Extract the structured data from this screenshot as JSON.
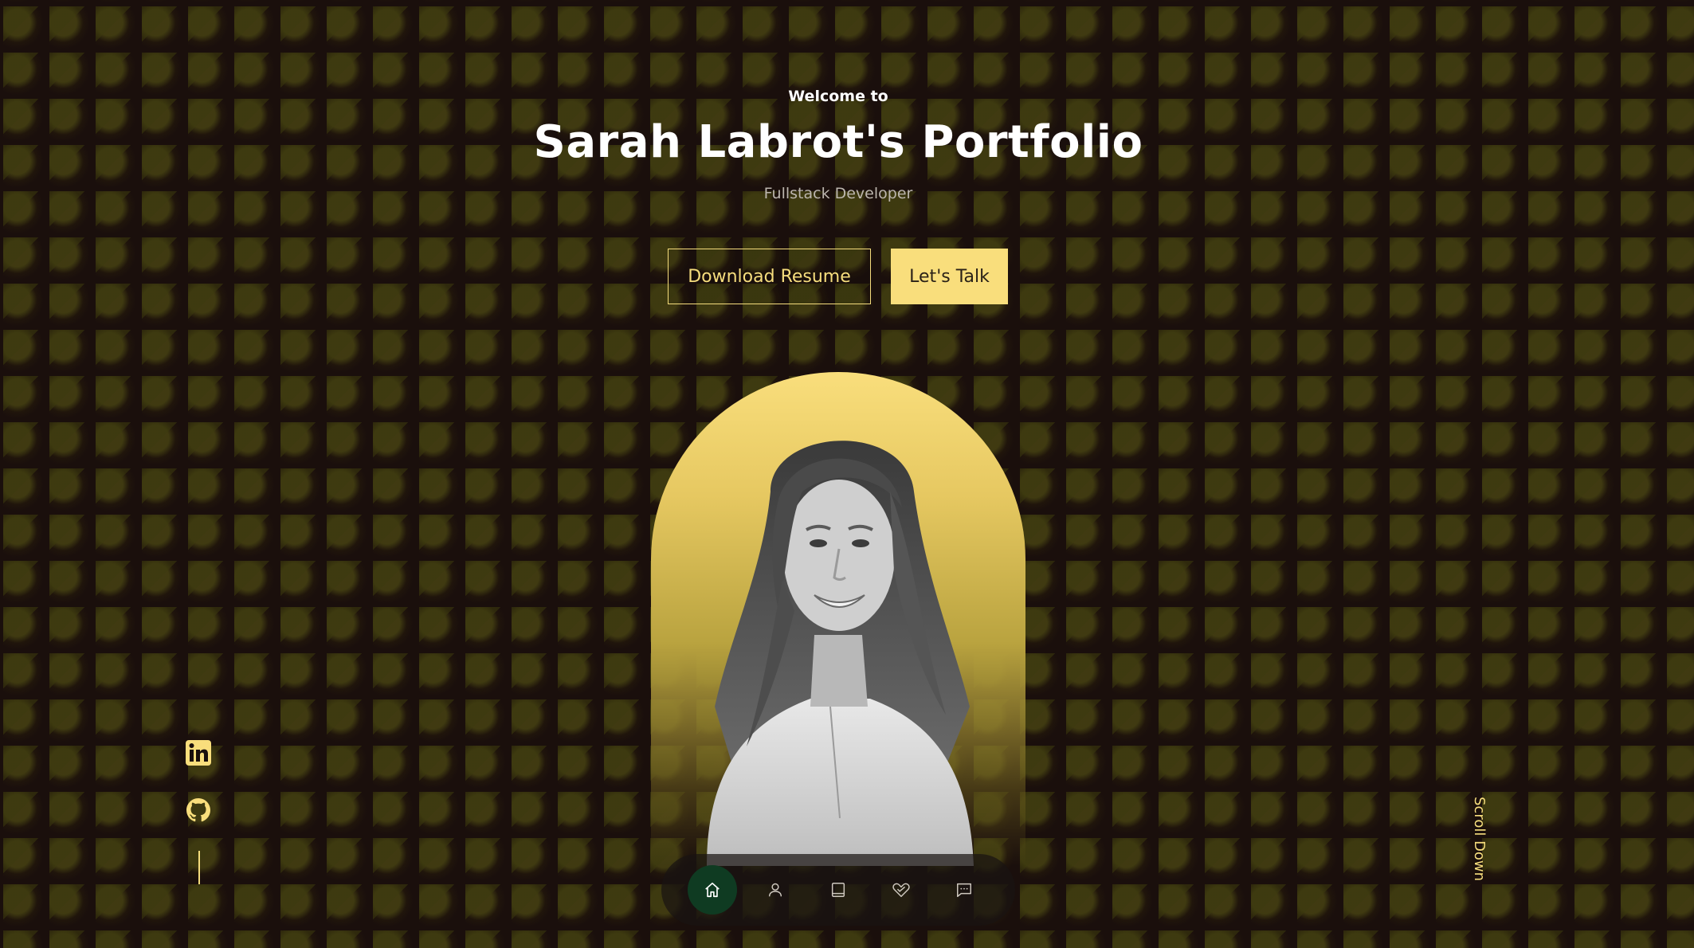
{
  "hero": {
    "welcome": "Welcome to",
    "title": "Sarah Labrot's Portfolio",
    "subtitle": "Fullstack Developer"
  },
  "buttons": {
    "download_resume": "Download Resume",
    "lets_talk": "Let's Talk"
  },
  "socials": [
    {
      "icon": "linkedin-icon"
    },
    {
      "icon": "github-icon"
    }
  ],
  "scroll": {
    "label": "Scroll Down"
  },
  "nav": {
    "items": [
      {
        "icon": "home-icon",
        "active": true
      },
      {
        "icon": "user-icon",
        "active": false
      },
      {
        "icon": "book-icon",
        "active": false
      },
      {
        "icon": "services-icon",
        "active": false
      },
      {
        "icon": "message-icon",
        "active": false
      }
    ]
  },
  "colors": {
    "accent": "#f9de7c",
    "background": "#1a0f0c",
    "nav_active": "#0f3b22"
  }
}
